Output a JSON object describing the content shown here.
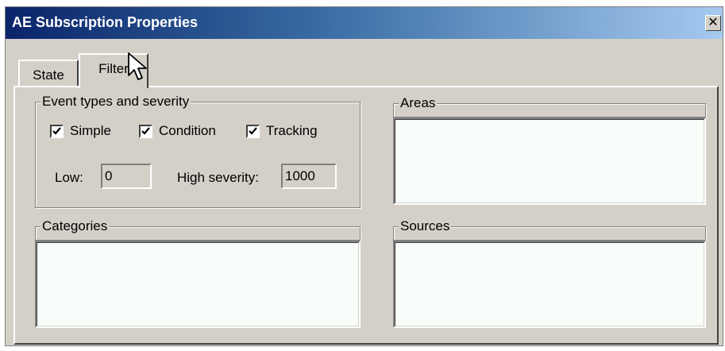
{
  "window": {
    "title": "AE Subscription Properties",
    "close_glyph": "✕"
  },
  "tabs": [
    {
      "label": "State",
      "selected": false
    },
    {
      "label": "Filter",
      "selected": true
    }
  ],
  "event_types": {
    "legend": "Event types and severity",
    "checkboxes": [
      {
        "label": "Simple",
        "checked": true
      },
      {
        "label": "Condition",
        "checked": true
      },
      {
        "label": "Tracking",
        "checked": true
      }
    ],
    "low_label": "Low:",
    "low_value": "0",
    "high_label": "High severity:",
    "high_value": "1000"
  },
  "areas": {
    "header": "Areas"
  },
  "categories": {
    "header": "Categories"
  },
  "sources": {
    "header": "Sources"
  },
  "icons": {
    "checkmark": "check-icon",
    "cursor": "mouse-pointer-icon"
  }
}
